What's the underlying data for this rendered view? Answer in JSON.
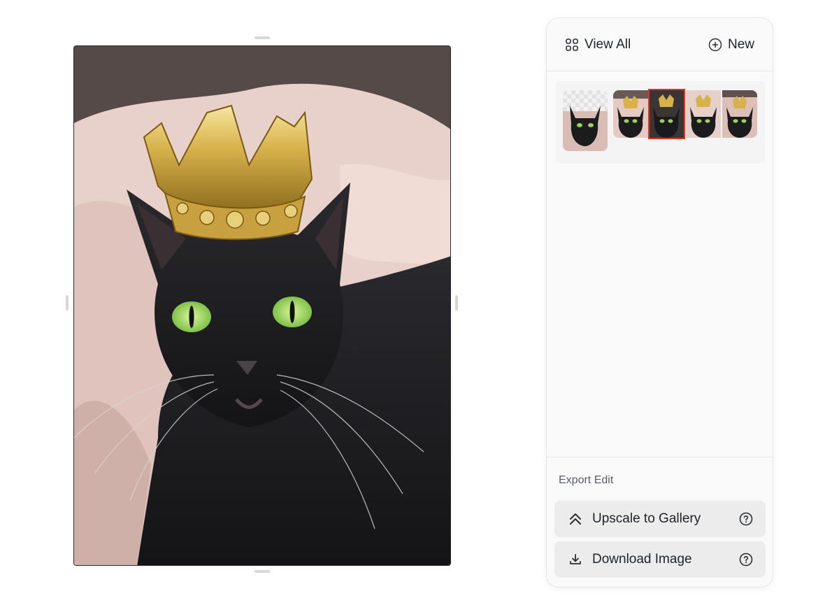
{
  "header": {
    "view_all_label": "View All",
    "new_label": "New"
  },
  "icons": {
    "view_all": "grid-icon",
    "new": "plus-circle-icon",
    "upscale": "double-chevron-up-icon",
    "download": "download-icon",
    "help": "help-circle-icon"
  },
  "thumbnails": {
    "selected_index": 2,
    "count": 5
  },
  "export": {
    "section_label": "Export Edit",
    "upscale_label": "Upscale to Gallery",
    "download_label": "Download Image"
  },
  "colors": {
    "selection_outline": "#e0341c",
    "panel_background": "#fafafa",
    "button_background": "#ececec"
  }
}
